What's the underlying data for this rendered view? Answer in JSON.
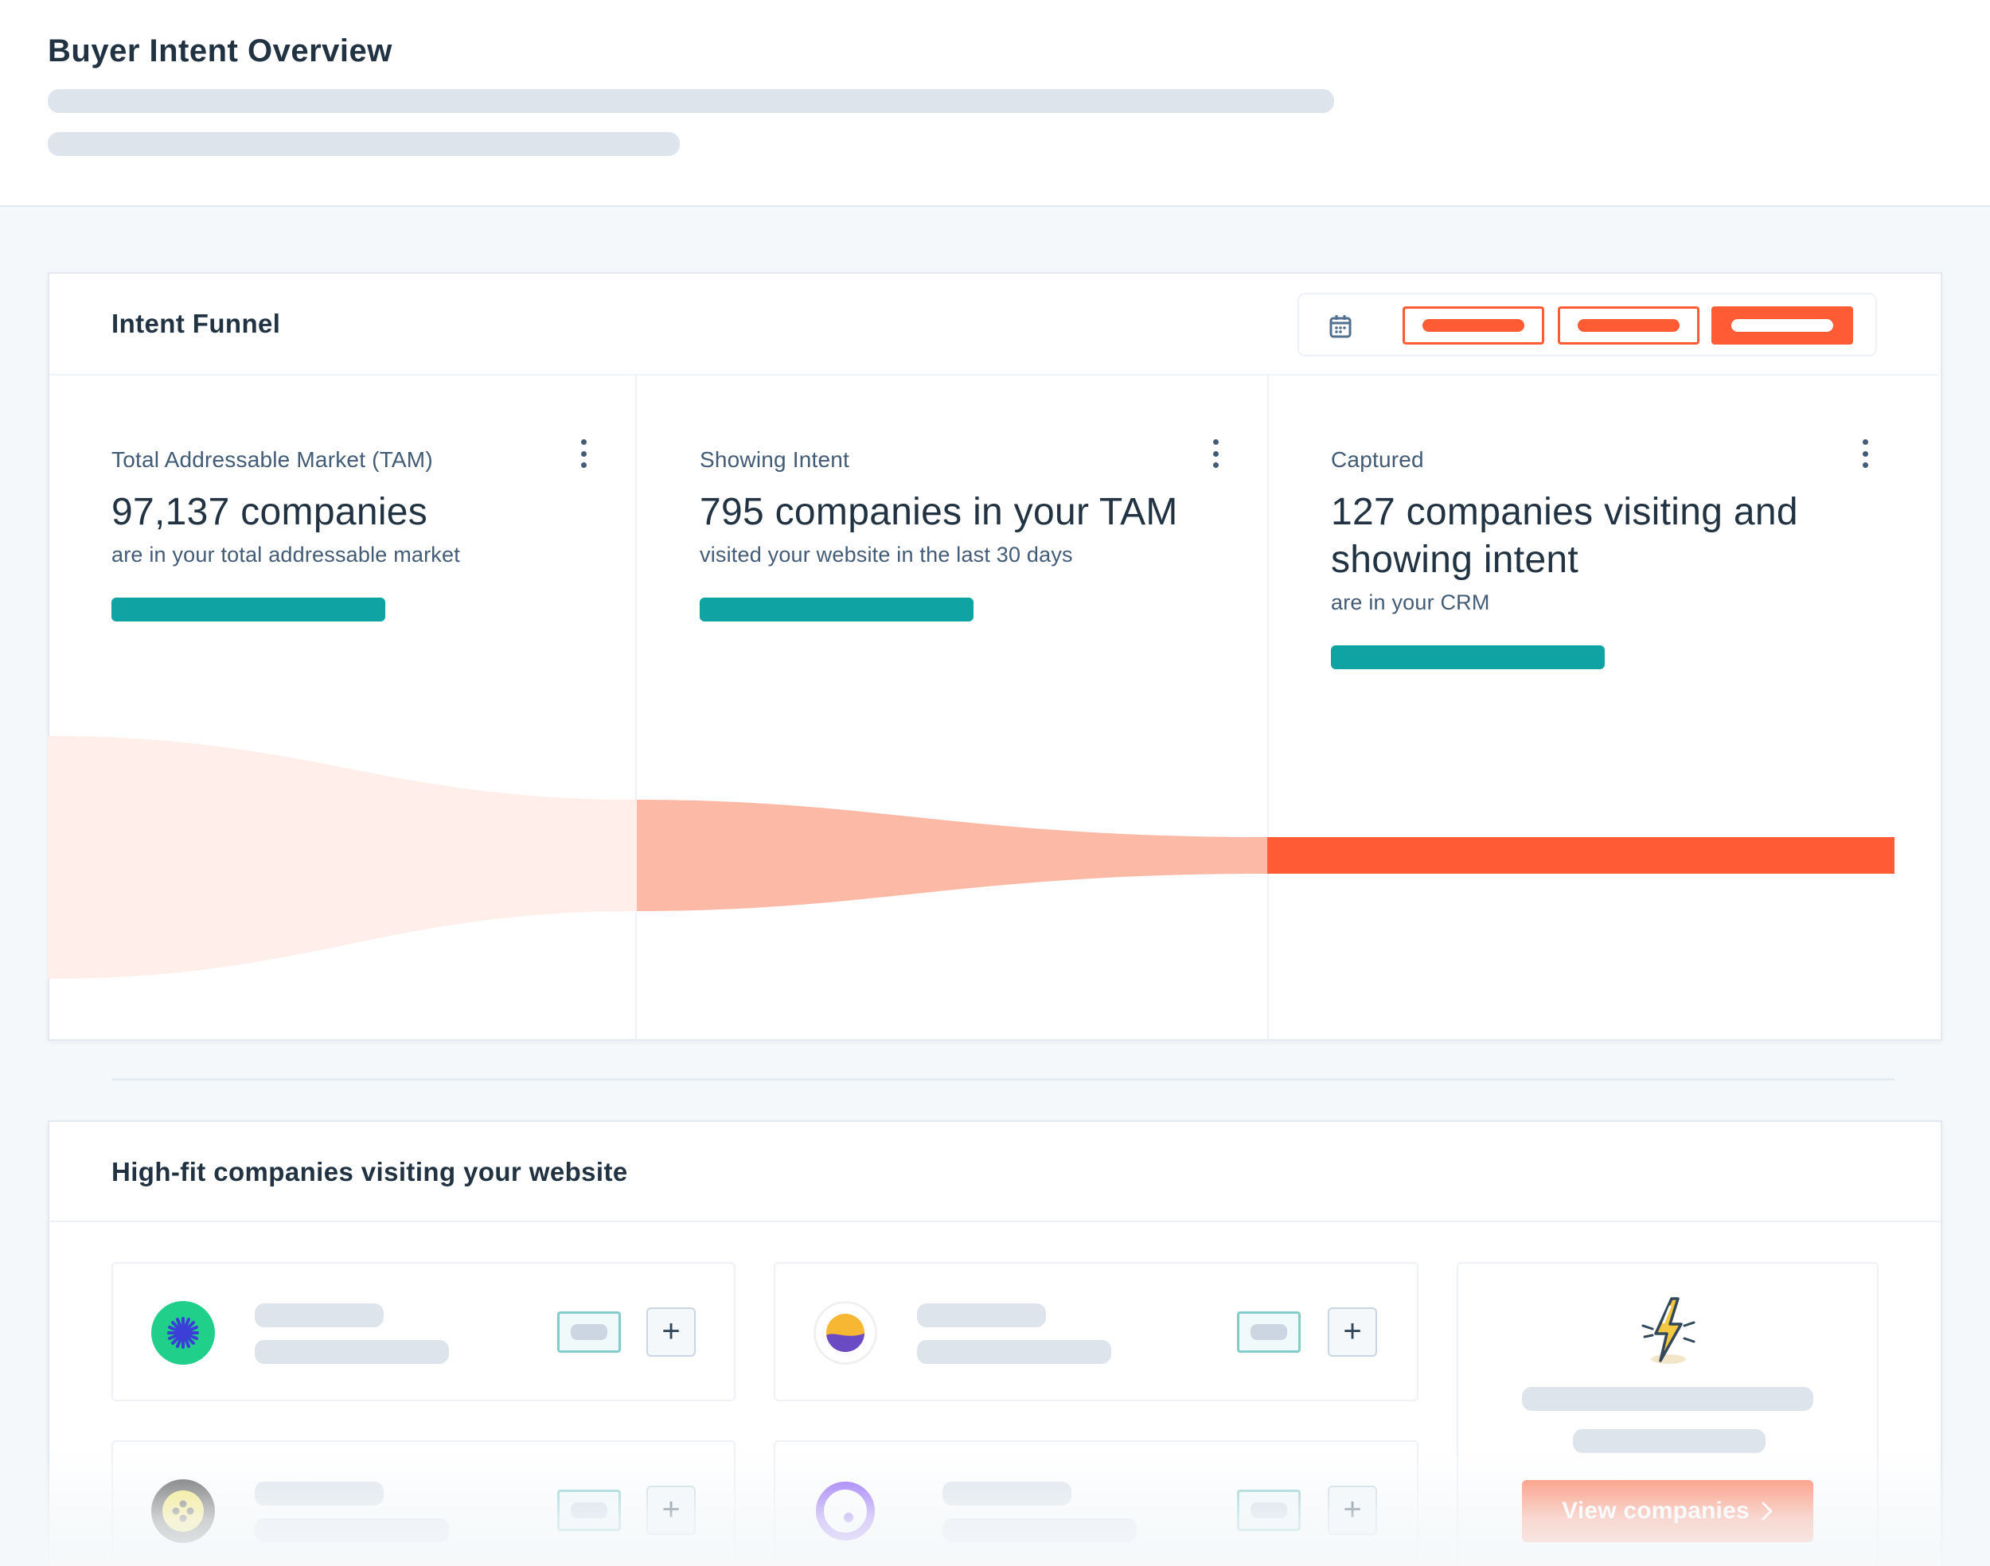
{
  "page": {
    "title": "Buyer Intent Overview"
  },
  "intent_funnel": {
    "title": "Intent Funnel",
    "active_range_index": 2,
    "columns": [
      {
        "label": "Total Addressable Market (TAM)",
        "value": "97,137 companies",
        "desc": "are in your total addressable market"
      },
      {
        "label": "Showing Intent",
        "value": "795 companies in your TAM",
        "desc": "visited your website in the last 30 days"
      },
      {
        "label": "Captured",
        "value": "127 companies visiting and showing intent",
        "desc": "are in your CRM"
      }
    ],
    "colors": {
      "stage1": "#ffeee9",
      "stage2": "#fcb9a6",
      "stage3": "#ff5c35",
      "progress": "#0fa3a3"
    }
  },
  "high_fit": {
    "title": "High-fit companies visiting your website",
    "companies": [
      {
        "logo": "green-asterisk-logo"
      },
      {
        "logo": "sunset-wave-logo"
      },
      {
        "logo": "yellow-dots-logo"
      },
      {
        "logo": "purple-ring-logo"
      }
    ],
    "cta": {
      "icon": "lightning-bolt-icon",
      "button_label": "View companies",
      "button_color": "#ff7a59"
    }
  }
}
